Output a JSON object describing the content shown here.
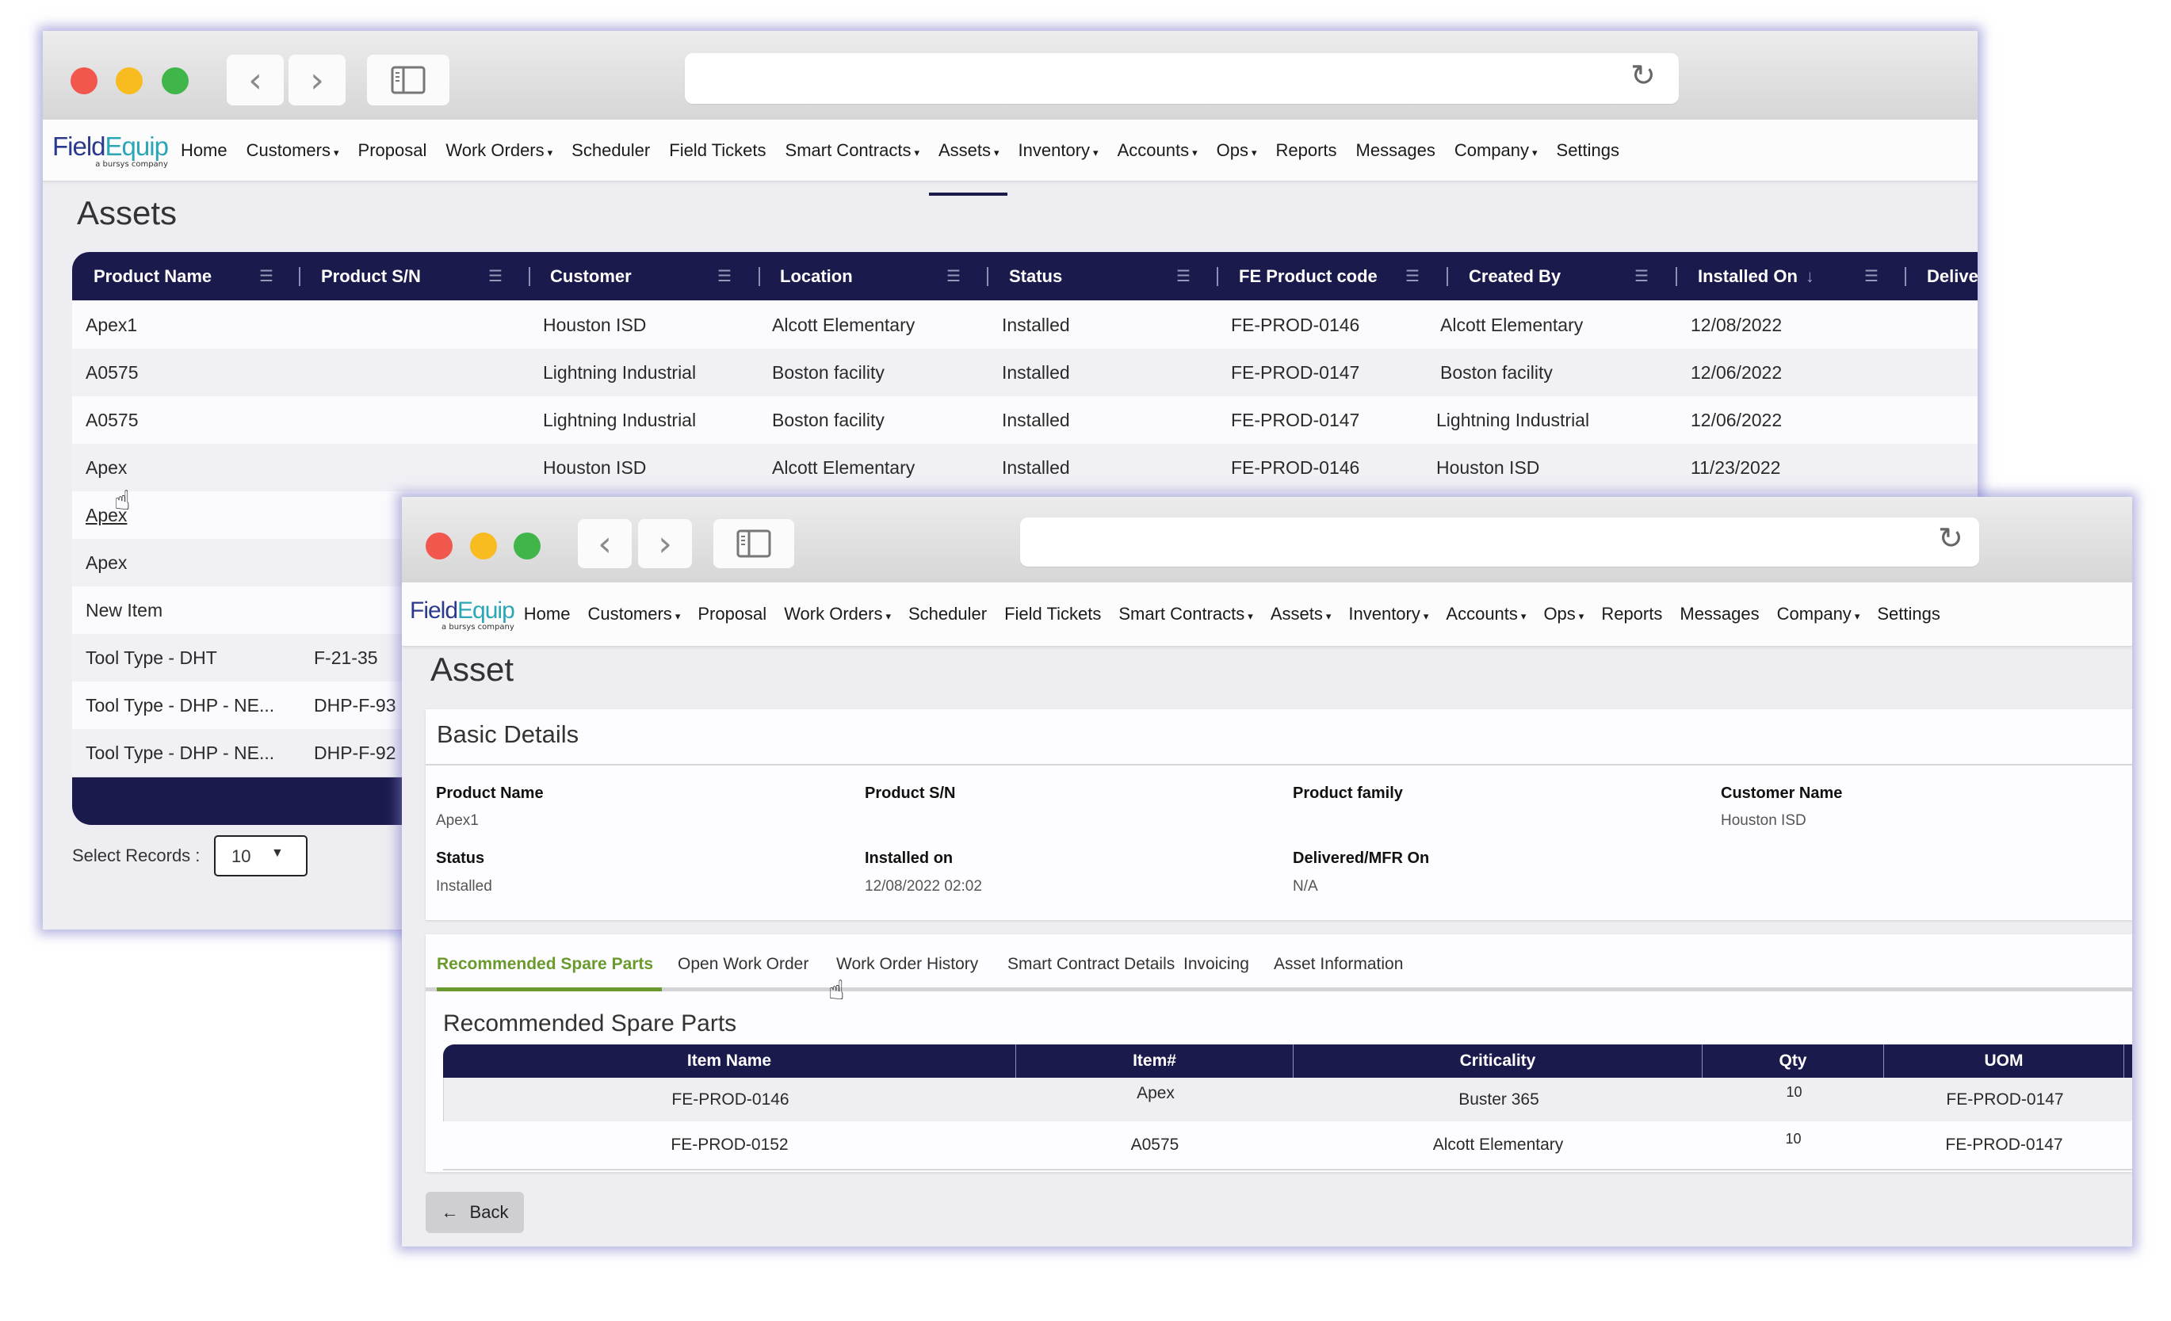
{
  "browser": {
    "url": "",
    "traffic_lights": {
      "close": "#f2574e",
      "minimize": "#f8bb20",
      "maximize": "#3fb54a"
    },
    "icons": {
      "back": "chevron-left-icon",
      "forward": "chevron-right-icon",
      "sidebar": "sidebar-icon",
      "reload": "reload-icon"
    }
  },
  "nav": {
    "logo_text_1": "Field",
    "logo_text_2": "Equip",
    "logo_sub": "a bursys company",
    "items": [
      {
        "label": "Home",
        "dropdown": false
      },
      {
        "label": "Customers",
        "dropdown": true
      },
      {
        "label": "Proposal",
        "dropdown": false
      },
      {
        "label": "Work Orders",
        "dropdown": true
      },
      {
        "label": "Scheduler",
        "dropdown": false
      },
      {
        "label": "Field Tickets",
        "dropdown": false
      },
      {
        "label": "Smart Contracts",
        "dropdown": true
      },
      {
        "label": "Assets",
        "dropdown": true
      },
      {
        "label": "Inventory",
        "dropdown": true
      },
      {
        "label": "Accounts",
        "dropdown": true
      },
      {
        "label": "Ops",
        "dropdown": true
      },
      {
        "label": "Reports",
        "dropdown": false
      },
      {
        "label": "Messages",
        "dropdown": false
      },
      {
        "label": "Company",
        "dropdown": true
      },
      {
        "label": "Settings",
        "dropdown": false
      }
    ],
    "active": "Assets",
    "chevron": "▾"
  },
  "assets_list": {
    "title": "Assets",
    "columns": [
      "Product Name",
      "Product S/N",
      "Customer",
      "Location",
      "Status",
      "FE Product code",
      "Created By",
      "Installed On",
      "Delive"
    ],
    "sort_icon": "↓",
    "menu_icon": "☰",
    "rows": [
      [
        "Apex1",
        "",
        "Houston ISD",
        "Alcott Elementary",
        "Installed",
        "FE-PROD-0146",
        "Alcott Elementary",
        "12/08/2022"
      ],
      [
        "A0575",
        "",
        "Lightning Industrial",
        "Boston facility",
        "Installed",
        "FE-PROD-0147",
        "Boston facility",
        "12/06/2022"
      ],
      [
        "A0575",
        "",
        "Lightning Industrial",
        "Boston facility",
        "Installed",
        "FE-PROD-0147",
        "Lightning Industrial",
        "12/06/2022"
      ],
      [
        "Apex",
        "",
        "Houston ISD",
        "Alcott Elementary",
        "Installed",
        "FE-PROD-0146",
        "Houston ISD",
        "11/23/2022"
      ],
      [
        "Apex",
        "",
        "",
        "",
        "",
        "",
        "",
        ""
      ],
      [
        "Apex",
        "",
        "",
        "",
        "",
        "",
        "",
        ""
      ],
      [
        "New Item",
        "",
        "",
        "",
        "",
        "",
        "",
        ""
      ],
      [
        "Tool Type - DHT",
        "F-21-35",
        "",
        "",
        "",
        "",
        "",
        ""
      ],
      [
        "Tool Type - DHP - NE...",
        "DHP-F-93",
        "",
        "",
        "",
        "",
        "",
        ""
      ],
      [
        "Tool Type - DHP - NE...",
        "DHP-F-92",
        "",
        "",
        "",
        "",
        "",
        ""
      ]
    ],
    "select_records_label": "Select Records :",
    "select_records_value": "10"
  },
  "asset_detail": {
    "title": "Asset",
    "basic_details_title": "Basic Details",
    "fields": [
      {
        "label": "Product Name",
        "value": "Apex1"
      },
      {
        "label": "Product S/N",
        "value": ""
      },
      {
        "label": "Product family",
        "value": ""
      },
      {
        "label": "Customer Name",
        "value": "Houston ISD"
      },
      {
        "label": "Status",
        "value": "Installed"
      },
      {
        "label": "Installed on",
        "value": "12/08/2022 02:02"
      },
      {
        "label": "Delivered/MFR On",
        "value": "N/A"
      }
    ],
    "tabs": [
      "Recommended Spare Parts",
      "Open Work Order",
      "Work Order History",
      "Smart Contract Details",
      "Invoicing",
      "Asset Information"
    ],
    "active_tab": "Recommended Spare Parts",
    "spare_parts_title": "Recommended Spare Parts",
    "spare_columns": [
      "Item Name",
      "Item#",
      "Criticality",
      "Qty",
      "UOM"
    ],
    "spare_rows": [
      [
        "FE-PROD-0146",
        "Apex",
        "Buster 365",
        "10",
        "FE-PROD-0147"
      ],
      [
        "FE-PROD-0152",
        "A0575",
        "Alcott Elementary",
        "10",
        "FE-PROD-0147"
      ]
    ],
    "back_label": "Back",
    "back_icon": "←"
  },
  "colors": {
    "header_navy": "#1b1a4c",
    "active_tab_green": "#6a9a2e",
    "logo_teal": "#2aa7b7"
  }
}
